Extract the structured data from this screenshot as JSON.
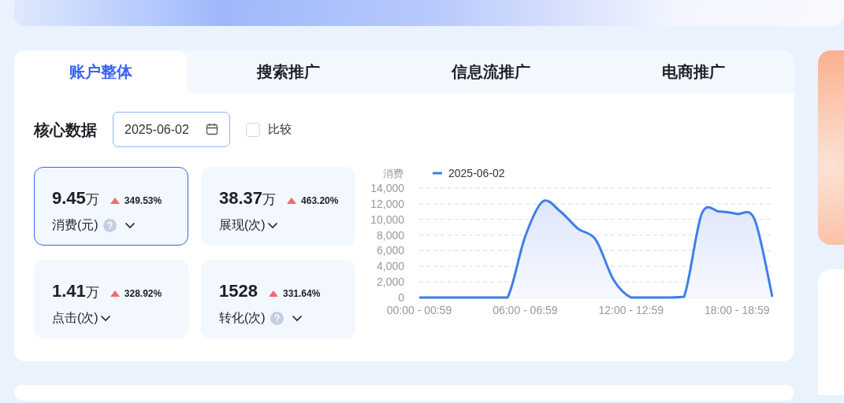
{
  "tabs": [
    {
      "label": "账户整体",
      "selected": true
    },
    {
      "label": "搜索推广",
      "selected": false
    },
    {
      "label": "信息流推广",
      "selected": false
    },
    {
      "label": "电商推广",
      "selected": false
    }
  ],
  "core_data": {
    "title": "核心数据",
    "date_field": {
      "value": "2025-06-02"
    },
    "compare": {
      "label": "比较",
      "checked": false
    }
  },
  "metrics": [
    {
      "value": "9.45",
      "unit": "万",
      "change": "349.53%",
      "label": "消费(元)",
      "help": true,
      "selected": true
    },
    {
      "value": "38.37",
      "unit": "万",
      "change": "463.20%",
      "label": "展现(次)",
      "help": false,
      "selected": false
    },
    {
      "value": "1.41",
      "unit": "万",
      "change": "328.92%",
      "label": "点击(次)",
      "help": false,
      "selected": false
    },
    {
      "value": "1528",
      "change": "331.64%",
      "label": "转化(次)",
      "help": true,
      "selected": false
    }
  ],
  "chart_data": {
    "type": "area",
    "grid": true,
    "ylabel": "消费",
    "categories": [
      "00:00 - 00:59",
      null,
      null,
      null,
      null,
      null,
      "06:00 - 06:59",
      null,
      null,
      null,
      null,
      null,
      "12:00 - 12:59",
      null,
      null,
      null,
      null,
      null,
      "18:00 - 18:59",
      null,
      null
    ],
    "series": [
      {
        "name": "2025-06-02",
        "color": "#3d7fe8",
        "values": [
          0,
          0,
          0,
          0,
          0,
          0,
          7800,
          12300,
          11000,
          8800,
          7400,
          2300,
          0,
          0,
          0,
          100,
          10700,
          11000,
          10700,
          10000,
          100
        ]
      }
    ],
    "ylim": [
      0,
      14000
    ],
    "yticks": [
      {
        "value": 0,
        "label": "0"
      },
      {
        "value": 2000,
        "label": "2,000"
      },
      {
        "value": 4000,
        "label": "4,000"
      },
      {
        "value": 6000,
        "label": "6,000"
      },
      {
        "value": 8000,
        "label": "8,000"
      },
      {
        "value": 10000,
        "label": "10,000"
      },
      {
        "value": 12000,
        "label": "12,000"
      },
      {
        "value": 14000,
        "label": "14,000"
      }
    ]
  }
}
